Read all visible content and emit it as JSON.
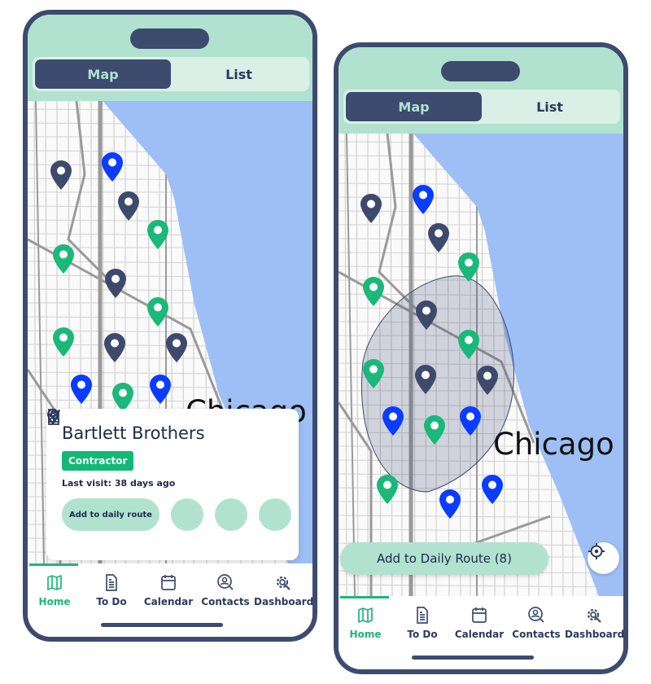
{
  "colors": {
    "brand_dark": "#3d4b6e",
    "mint": "#b1e2d0",
    "green": "#1ab87a",
    "water": "#9dbff5",
    "pin_dark": "#3d4a6b",
    "pin_blue": "#0a3cff",
    "pin_green": "#1ab87a"
  },
  "tabs": {
    "map": "Map",
    "list": "List"
  },
  "map": {
    "city_label": "Chicago"
  },
  "card": {
    "title": "Bartlett Brothers",
    "badge": "Contractor",
    "last_visit": "Last visit: 38 days ago",
    "add_route": "Add to daily route",
    "actions": [
      "navigate-icon",
      "person-icon",
      "add-document-icon"
    ]
  },
  "route_button": "Add to Daily Route (8)",
  "nav": [
    {
      "label": "Home",
      "icon": "map-icon",
      "active": true
    },
    {
      "label": "To Do",
      "icon": "document-icon"
    },
    {
      "label": "Calendar",
      "icon": "calendar-icon"
    },
    {
      "label": "Contacts",
      "icon": "contact-search-icon"
    },
    {
      "label": "Dashboard",
      "icon": "gear-wrench-icon"
    }
  ]
}
